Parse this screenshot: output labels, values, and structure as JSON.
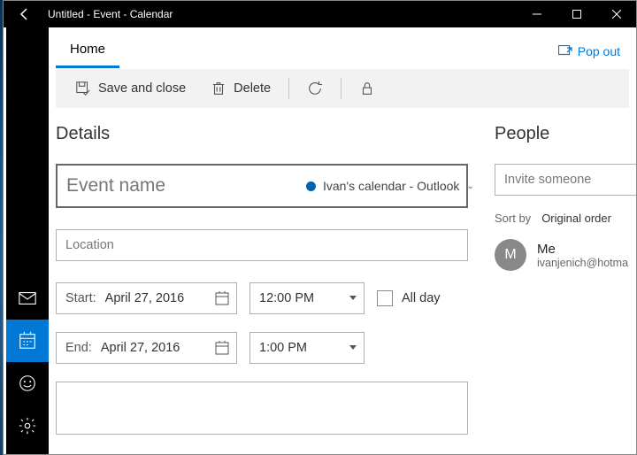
{
  "window": {
    "title": "Untitled - Event - Calendar"
  },
  "tabs": {
    "home": "Home",
    "popout": "Pop out"
  },
  "toolbar": {
    "save_close": "Save and close",
    "delete": "Delete"
  },
  "details": {
    "heading": "Details",
    "event_name_placeholder": "Event name",
    "calendar_label": "Ivan's calendar - Outlook",
    "location_placeholder": "Location",
    "start_label": "Start:",
    "end_label": "End:",
    "start_date": "April 27, 2016",
    "end_date": "April 27, 2016",
    "start_time": "12:00 PM",
    "end_time": "1:00 PM",
    "allday_label": "All day"
  },
  "people": {
    "heading": "People",
    "invite_placeholder": "Invite someone",
    "sortby_label": "Sort by",
    "sortby_value": "Original order",
    "me_avatar": "M",
    "me_name": "Me",
    "me_email": "ivanjenich@hotma"
  }
}
